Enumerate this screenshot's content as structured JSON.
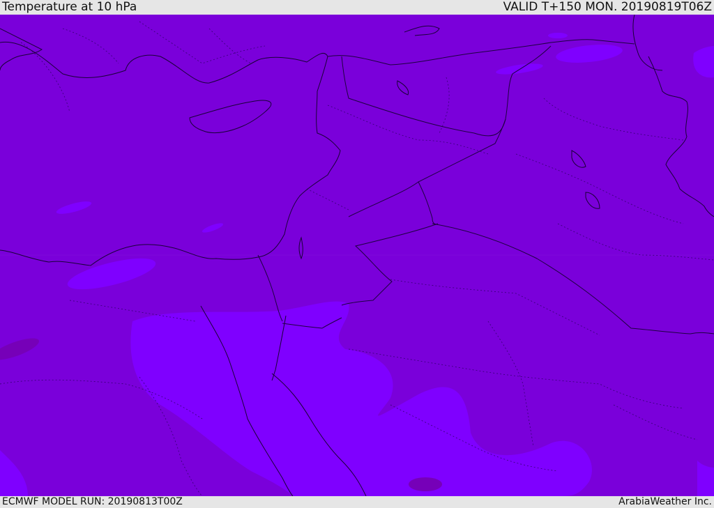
{
  "header": {
    "title": "Temperature at 10 hPa",
    "valid": "VALID T+150 MON. 20190819T06Z"
  },
  "footer": {
    "model_run": "ECMWF MODEL RUN: 20190813T00Z",
    "credit": "ArabiaWeather Inc."
  },
  "map": {
    "field": "temperature-10hPa",
    "colors": {
      "base": "#7a00da",
      "warmer": "#7f00ff",
      "cooler": "#7800b8",
      "coastline": "#1a0038",
      "border": "#2a0060"
    }
  }
}
